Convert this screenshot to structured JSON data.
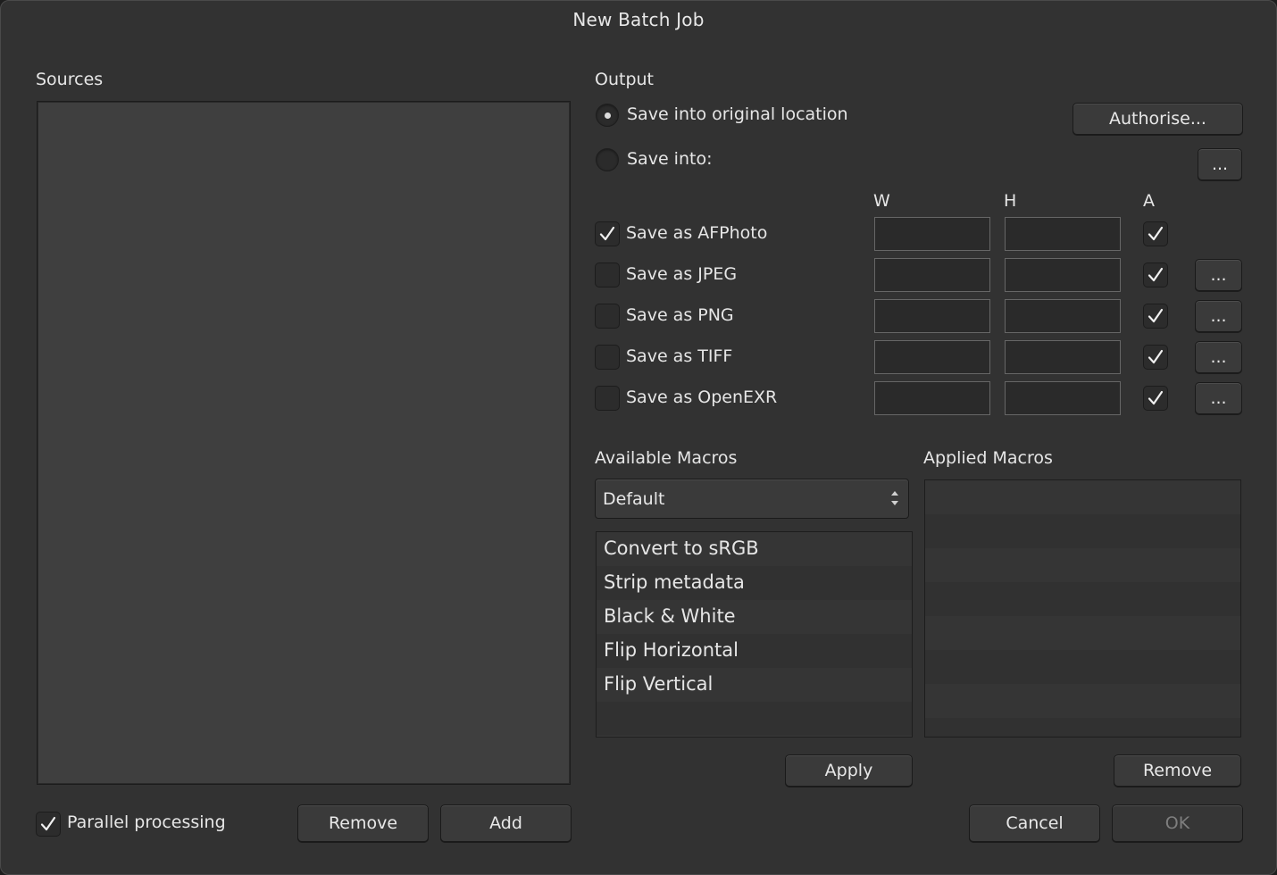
{
  "window": {
    "title": "New Batch Job"
  },
  "sources": {
    "heading": "Sources"
  },
  "output": {
    "heading": "Output",
    "save_original_label": "Save into original location",
    "save_into_label": "Save into:",
    "authorise_label": "Authorise...",
    "browse_label": "...",
    "col_w": "W",
    "col_h": "H",
    "col_a": "A",
    "formats": [
      {
        "label": "Save as AFPhoto",
        "checked": true,
        "alpha": true,
        "has_options": false
      },
      {
        "label": "Save as JPEG",
        "checked": false,
        "alpha": true,
        "has_options": true,
        "options_label": "..."
      },
      {
        "label": "Save as PNG",
        "checked": false,
        "alpha": true,
        "has_options": true,
        "options_label": "..."
      },
      {
        "label": "Save as TIFF",
        "checked": false,
        "alpha": true,
        "has_options": true,
        "options_label": "..."
      },
      {
        "label": "Save as OpenEXR",
        "checked": false,
        "alpha": true,
        "has_options": true,
        "options_label": "..."
      }
    ]
  },
  "macros": {
    "available_heading": "Available Macros",
    "applied_heading": "Applied Macros",
    "category_selected": "Default",
    "available": [
      "Convert to sRGB",
      "Strip metadata",
      "Black & White",
      "Flip Horizontal",
      "Flip Vertical"
    ],
    "apply_label": "Apply",
    "remove_label": "Remove"
  },
  "footer": {
    "parallel_label": "Parallel processing",
    "parallel_checked": true,
    "remove_label": "Remove",
    "add_label": "Add",
    "cancel_label": "Cancel",
    "ok_label": "OK"
  }
}
